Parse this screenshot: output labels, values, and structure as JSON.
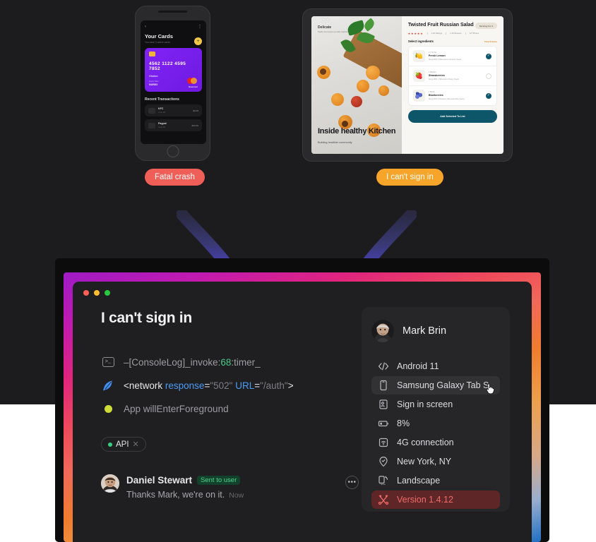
{
  "devices": {
    "phone": {
      "nav_back_icon": "chevron-left-icon",
      "menu_icon": "kebab-menu-icon",
      "title": "Your Cards",
      "subtitle": "You have 3 active cards",
      "add_icon": "plus-icon",
      "card": {
        "number": "4562 1122 4595 7852",
        "holder": "Oholon",
        "exp_label": "Expiry Date",
        "exp_value": "04/2021",
        "brand": "Mastercard"
      },
      "transactions_title": "Recent Transactions",
      "transactions": [
        {
          "name": "KFC",
          "date": "June 28",
          "amount": "-$2.00"
        },
        {
          "name": "Paypal",
          "date": "June 28",
          "amount": "-$10.00"
        }
      ]
    },
    "tablet": {
      "brand": "Delicate",
      "brand_sub": "Healthy food recipes and daily inspiration",
      "hero_title": "Inside healthy Kitchen",
      "hero_sub": "Building healthier community",
      "recipe_title": "Twisted Fruit Russian Salad",
      "serving_badge": "Serving For 2",
      "ratings": "2.4K Ratings",
      "reviews": "1.4K Reviews",
      "photos": "127 Photos",
      "section_title": "Select ingredients",
      "section_action": "Total 8 Items",
      "ingredients": [
        {
          "qty": "1 X SLICE",
          "name": "Fresh Lemon",
          "desc": "Along With 2 Tablespoons Sesame Seeds",
          "selected": true,
          "emoji": "🍋"
        },
        {
          "qty": "2 PIECES",
          "name": "Strawberries",
          "desc": "Along With 1 Tablespoon Poppy Seeds",
          "selected": false,
          "emoji": "🍓"
        },
        {
          "qty": "1 BOWL",
          "name": "Blueberries",
          "desc": "Along With 2 Teaspoon Worcestershire Sauce",
          "selected": true,
          "emoji": "🫐"
        }
      ],
      "cta": "Add Selected To List"
    }
  },
  "pills": {
    "crash": {
      "label": "Fatal crash",
      "color": "#ef5f58"
    },
    "signin": {
      "label": "I can't sign in",
      "color": "#f6a52a"
    }
  },
  "window": {
    "traffic_lights": [
      "#ff5f57",
      "#febc2e",
      "#28c840"
    ],
    "title": "I can't sign in",
    "logs": [
      {
        "icon": "terminal-icon",
        "prefix": "–[ConsoleLog]_invoke:",
        "number": "68",
        "suffix": ":timer_"
      },
      {
        "icon": "feather-icon",
        "tag_open": "<network ",
        "attr1": "response",
        "eq1": "=",
        "val1": "\"502\"",
        "attr2": " URL",
        "eq2": "=",
        "val2": "\"/auth\"",
        "tag_close": ">"
      },
      {
        "icon": "status-dot-icon",
        "text": "App willEnterForeground"
      }
    ],
    "tags": [
      {
        "label": "API",
        "dot_color": "#35d07f",
        "close_icon": "close-icon"
      }
    ],
    "comment": {
      "author": "Daniel Stewart",
      "badge": "Sent to user",
      "message": "Thanks Mark, we're on it.",
      "time": "Now",
      "more_icon": "ellipsis-icon"
    }
  },
  "device_card": {
    "user_name": "Mark Brin",
    "specs": [
      {
        "icon": "code-icon",
        "label": "Android 11",
        "state": "normal"
      },
      {
        "icon": "mobile-icon",
        "label": "Samsung Galaxy Tab S",
        "state": "hover"
      },
      {
        "icon": "screen-user-icon",
        "label": "Sign in screen",
        "state": "normal"
      },
      {
        "icon": "battery-icon",
        "label": "8%",
        "state": "normal"
      },
      {
        "icon": "signal-icon",
        "label": "4G connection",
        "state": "normal"
      },
      {
        "icon": "location-icon",
        "label": "New York, NY",
        "state": "normal"
      },
      {
        "icon": "orientation-icon",
        "label": "Landscape",
        "state": "normal"
      },
      {
        "icon": "tools-icon",
        "label": "Version 1.4.12",
        "state": "warning"
      }
    ]
  }
}
